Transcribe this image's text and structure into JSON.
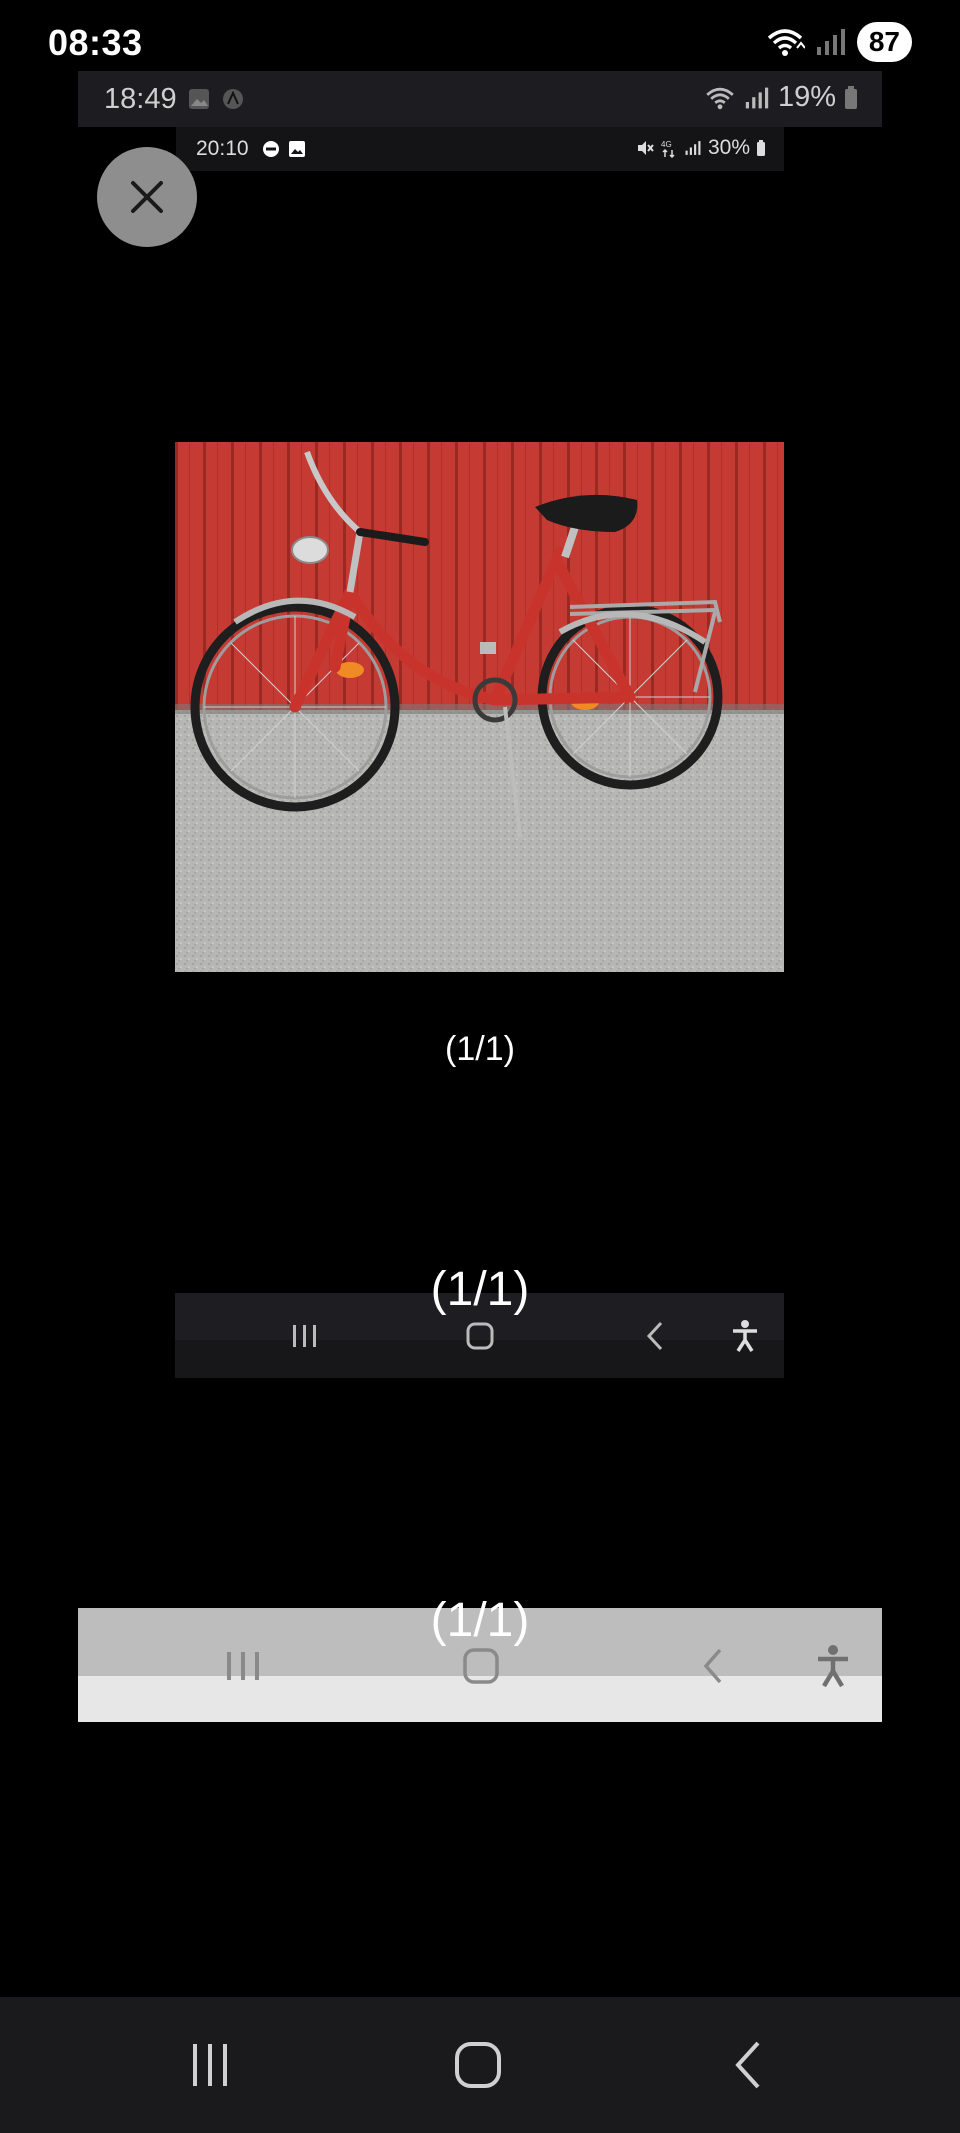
{
  "status_bar": {
    "time": "08:33",
    "battery": "87"
  },
  "nested_status_1": {
    "time": "18:49",
    "battery": "19%"
  },
  "nested_status_2": {
    "time": "20:10",
    "battery": "30%"
  },
  "viewer": {
    "counter_1": "(1/1)",
    "counter_2": "(1/1)",
    "counter_3": "(1/1)",
    "photo_subject": "red-bicycle"
  },
  "icons": {
    "close": "close-icon",
    "recents": "recents-icon",
    "home": "home-icon",
    "back": "back-icon",
    "accessibility": "accessibility-icon"
  },
  "colors": {
    "background": "#000000",
    "close_button": "#8e8e8e",
    "bike_frame": "#c8342c",
    "wall": "#c43a32"
  }
}
